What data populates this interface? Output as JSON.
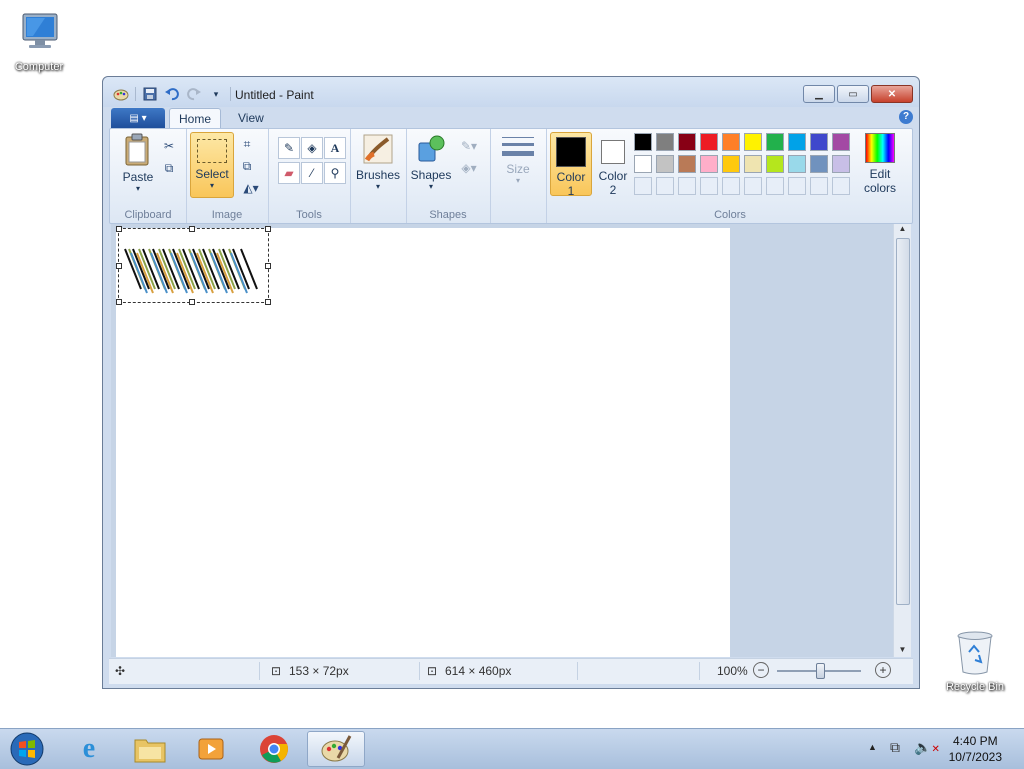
{
  "desktop": {
    "icons": [
      {
        "label": "Computer"
      },
      {
        "label": "Recycle Bin"
      }
    ]
  },
  "window": {
    "title": "Untitled - Paint",
    "tabs": [
      {
        "label": "Home"
      },
      {
        "label": "View"
      }
    ],
    "ribbon": {
      "clipboard": {
        "paste_label": "Paste",
        "group_label": "Clipboard"
      },
      "image": {
        "select_label": "Select",
        "group_label": "Image"
      },
      "tools": {
        "group_label": "Tools"
      },
      "brushes": {
        "label": "Brushes"
      },
      "shapes": {
        "label": "Shapes",
        "group_label": "Shapes"
      },
      "size": {
        "label": "Size"
      },
      "colors": {
        "color1_label": "Color",
        "color1_num": "1",
        "color2_label": "Color",
        "color2_num": "2",
        "edit_label": "Edit",
        "edit_label2": "colors",
        "group_label": "Colors",
        "color1": "#000000",
        "color2": "#ffffff",
        "palette_row1": [
          "#000000",
          "#7f7f7f",
          "#880015",
          "#ed1c24",
          "#ff7f27",
          "#fff200",
          "#22b14c",
          "#00a2e8",
          "#3f48cc",
          "#a349a4"
        ],
        "palette_row2": [
          "#ffffff",
          "#c3c3c3",
          "#b97a57",
          "#ffaec9",
          "#ffc90e",
          "#efe4b0",
          "#b5e61d",
          "#99d9ea",
          "#7092be",
          "#c8bfe7"
        ]
      }
    },
    "statusbar": {
      "selection_size": "153 × 72px",
      "image_size": "614 × 460px",
      "zoom": "100%"
    }
  },
  "taskbar": {
    "time": "4:40 PM",
    "date": "10/7/2023"
  }
}
